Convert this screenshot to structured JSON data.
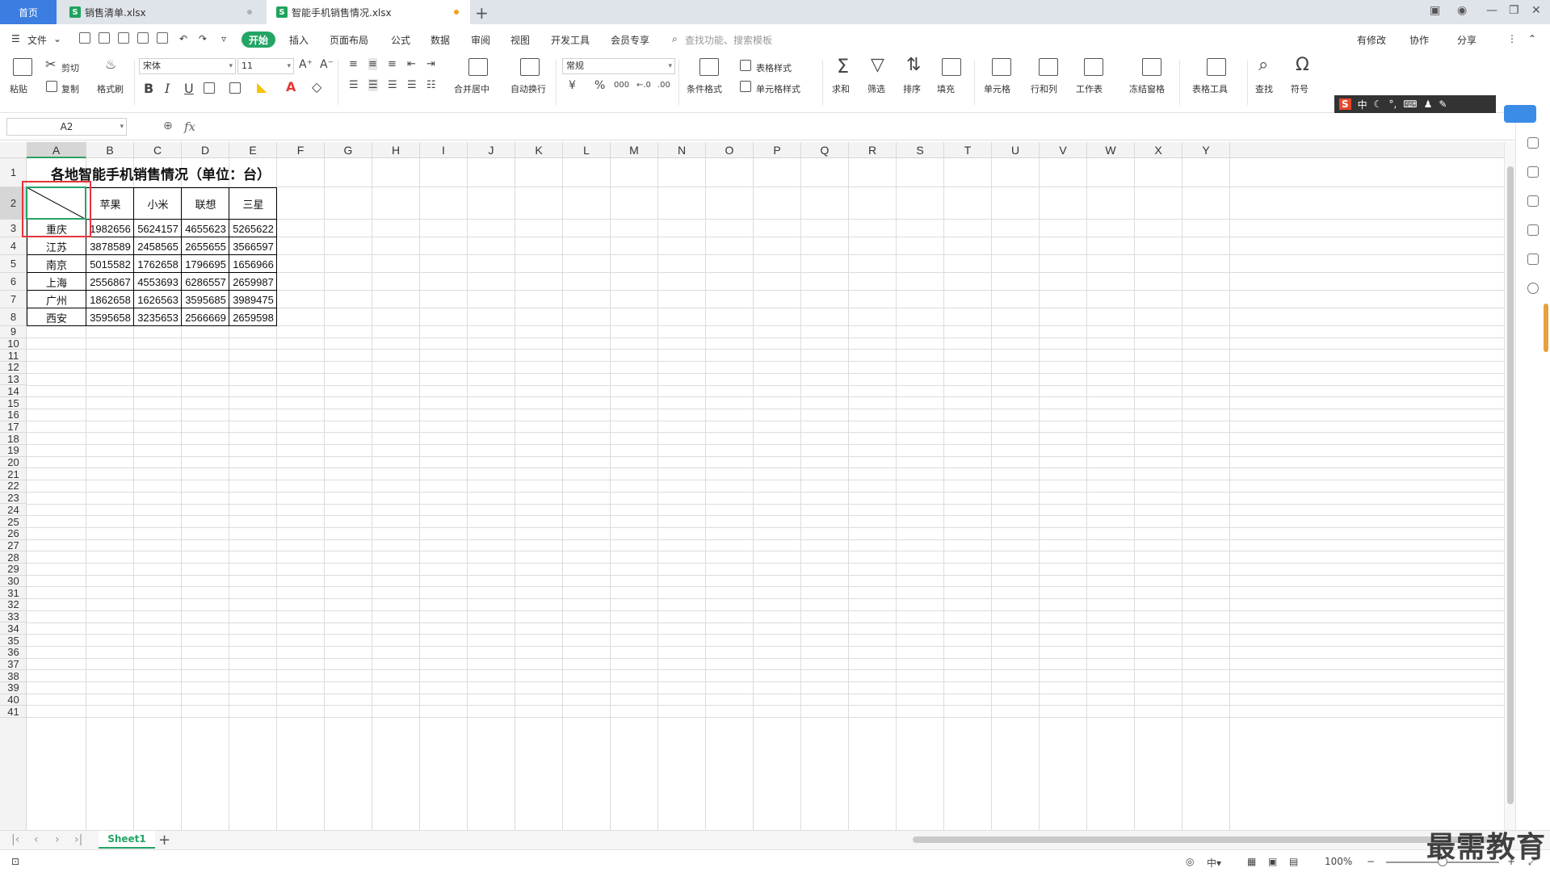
{
  "tabs": {
    "home": "首页",
    "file1": "销售清单.xlsx",
    "file2": "智能手机销售情况.xlsx",
    "new_tab": "+"
  },
  "menu": {
    "file": "文件",
    "start": "开始",
    "items": [
      "插入",
      "页面布局",
      "公式",
      "数据",
      "审阅",
      "视图",
      "开发工具",
      "会员专享"
    ],
    "search_placeholder": "查找功能、搜索模板",
    "modified": "有修改",
    "collab": "协作",
    "share": "分享"
  },
  "ribbon": {
    "paste": "粘贴",
    "cut": "剪切",
    "copy": "复制",
    "format_painter": "格式刷",
    "font_name": "宋体",
    "font_size": "11",
    "bold": "B",
    "italic": "I",
    "underline": "U",
    "merge_center": "合并居中",
    "auto_wrap": "自动换行",
    "number_format": "常规",
    "currency": "¥",
    "percent": "%",
    "thousands": "000",
    "cond_format": "条件格式",
    "table_style": "表格样式",
    "cell_style": "单元格样式",
    "sum": "求和",
    "filter": "筛选",
    "sort": "排序",
    "fill": "填充",
    "cell": "单元格",
    "row_col": "行和列",
    "worksheet": "工作表",
    "freeze": "冻结窗格",
    "table_tools": "表格工具",
    "find": "查找",
    "symbol": "符号"
  },
  "ime": {
    "s": "S",
    "mode": "中"
  },
  "formula_bar": {
    "name_box": "A2",
    "fx": "fx",
    "value": ""
  },
  "columns": [
    "A",
    "B",
    "C",
    "D",
    "E",
    "F",
    "G",
    "H",
    "I",
    "J",
    "K",
    "L",
    "M",
    "N",
    "O",
    "P",
    "Q",
    "R",
    "S",
    "T",
    "U",
    "V",
    "W",
    "X",
    "Y"
  ],
  "rows": [
    "1",
    "2",
    "3",
    "4",
    "5",
    "6",
    "7",
    "8",
    "9",
    "10",
    "11",
    "12",
    "13",
    "14",
    "15",
    "16",
    "17",
    "18",
    "19",
    "20",
    "21",
    "22",
    "23",
    "24",
    "25",
    "26",
    "27",
    "28",
    "29",
    "30",
    "31",
    "32",
    "33",
    "34",
    "35",
    "36",
    "37",
    "38",
    "39",
    "40",
    "41"
  ],
  "sheet": {
    "title": "各地智能手机销售情况（单位：台）",
    "headers": [
      "苹果",
      "小米",
      "联想",
      "三星"
    ],
    "table": [
      {
        "city": "重庆",
        "values": [
          "1982656",
          "5624157",
          "4655623",
          "5265622"
        ]
      },
      {
        "city": "江苏",
        "values": [
          "3878589",
          "2458565",
          "2655655",
          "3566597"
        ]
      },
      {
        "city": "南京",
        "values": [
          "5015582",
          "1762658",
          "1796695",
          "1656966"
        ]
      },
      {
        "city": "上海",
        "values": [
          "2556867",
          "4553693",
          "6286557",
          "2659987"
        ]
      },
      {
        "city": "广州",
        "values": [
          "1862658",
          "1626563",
          "3595685",
          "3989475"
        ]
      },
      {
        "city": "西安",
        "values": [
          "3595658",
          "3235653",
          "2566669",
          "2659598"
        ]
      }
    ]
  },
  "sheet_tabs": {
    "active": "Sheet1",
    "add": "+"
  },
  "status": {
    "zoom": "100%",
    "zoom_minus": "−",
    "zoom_plus": "+"
  },
  "watermark": "最需教育",
  "colors": {
    "accent": "#23a566",
    "highlight": "#e5343a",
    "home_tab": "#3b7de0",
    "tab_dot": "#f0a020"
  }
}
